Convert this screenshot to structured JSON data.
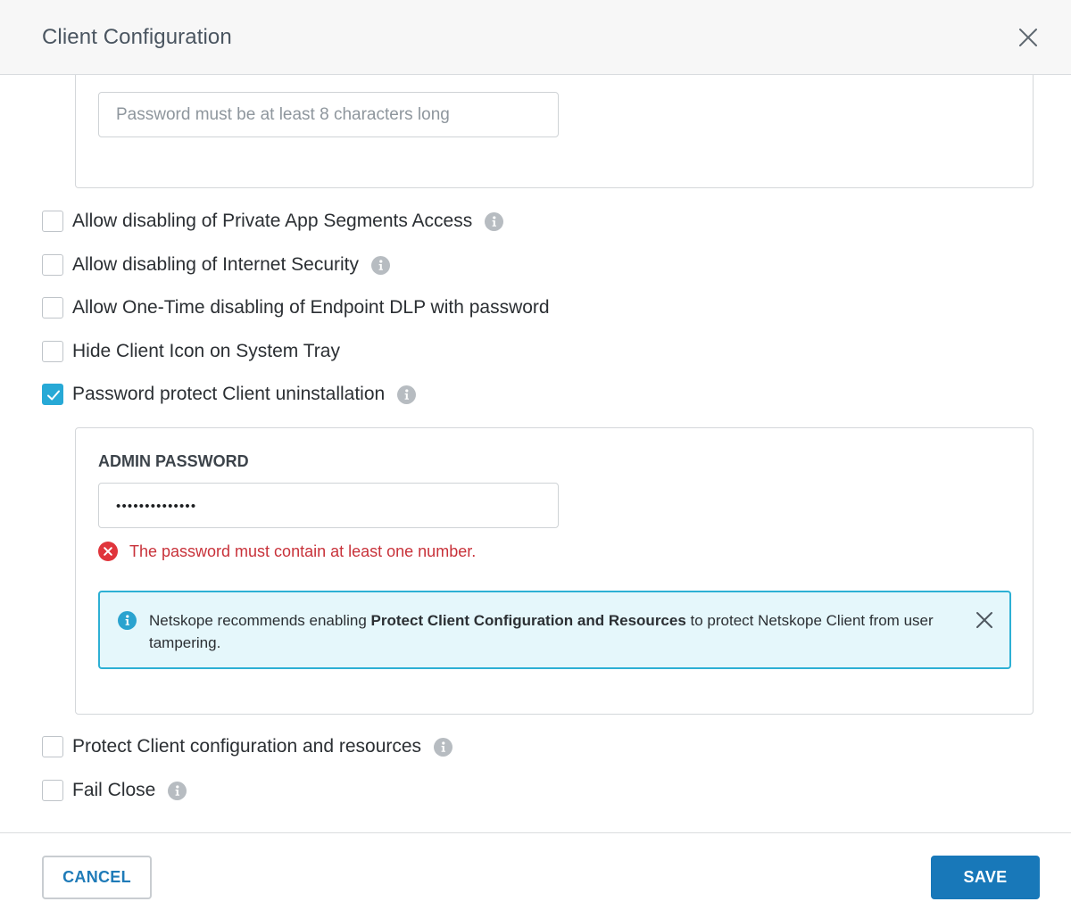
{
  "dialog": {
    "title": "Client Configuration"
  },
  "top_password": {
    "placeholder": "Password must be at least 8 characters long"
  },
  "options": [
    {
      "label": "Allow disabling of Private App Segments Access",
      "checked": false,
      "info": true
    },
    {
      "label": "Allow disabling of Internet Security",
      "checked": false,
      "info": true
    },
    {
      "label": "Allow One-Time disabling of Endpoint DLP with password",
      "checked": false,
      "info": false
    },
    {
      "label": "Hide Client Icon on System Tray",
      "checked": false,
      "info": false
    },
    {
      "label": "Password protect Client uninstallation",
      "checked": true,
      "info": true
    },
    {
      "label": "Protect Client configuration and resources",
      "checked": false,
      "info": true
    },
    {
      "label": "Fail Close",
      "checked": false,
      "info": true
    }
  ],
  "admin_password": {
    "label": "ADMIN PASSWORD",
    "value": "••••••••••••••",
    "error": "The password must contain at least one number."
  },
  "banner": {
    "text_before": "Netskope recommends enabling ",
    "text_bold": "Protect Client Configuration and Resources",
    "text_after": " to protect Netskope Client from user tampering."
  },
  "footer": {
    "cancel_label": "CANCEL",
    "save_label": "SAVE"
  },
  "colors": {
    "accent": "#27a9d6",
    "primary_button": "#1878b9",
    "error": "#c8323a",
    "banner_bg": "#e5f7fb",
    "banner_border": "#2db0d4"
  }
}
